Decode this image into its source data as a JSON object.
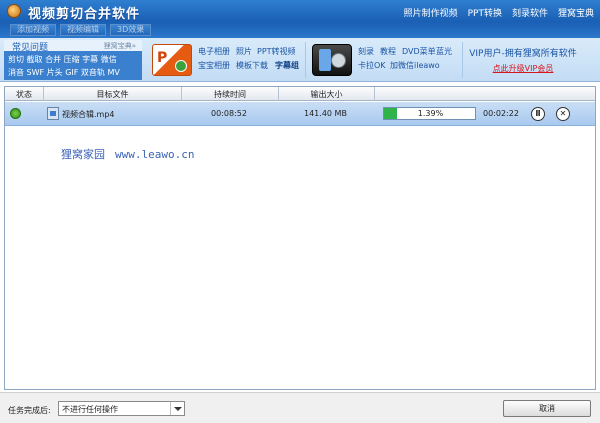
{
  "window": {
    "title": "视频剪切合并软件",
    "top_links": [
      "照片制作视频",
      "PPT转换",
      "刻录软件",
      "狸窝宝典"
    ]
  },
  "toolbar": {
    "buttons": [
      "添加视频",
      "视频编辑",
      "3D效果"
    ]
  },
  "banner": {
    "faq": {
      "title": "常见问题",
      "tag": "狸窝宝典»",
      "row1": "剪切 截取 合并 压缩 字幕 微信",
      "row2": "消音 SWF 片头 GIF 双音轨 MV"
    },
    "feature1": {
      "icon": "ppt-icon",
      "line1_a": "电子相册",
      "line1_b": "照片",
      "line1_c": "PPT转视频",
      "line2_a": "宝宝相册",
      "line2_b": "模板下载",
      "line2_c": "字幕组"
    },
    "feature2": {
      "icon": "phone-dvd-icon",
      "line1_a": "刻录",
      "line1_b": "教程",
      "line1_c": "DVD菜单",
      "line1_d": "蓝光",
      "line2_a": "卡拉OK",
      "line2_b": "加微信ileawo"
    },
    "vip": {
      "text": "VIP用户-拥有狸窝所有软件",
      "link": "点此升级VIP会员"
    }
  },
  "table": {
    "headers": {
      "status": "状态",
      "file": "目标文件",
      "duration": "持续时间",
      "size": "输出大小"
    },
    "rows": [
      {
        "file": "视频合辑.mp4",
        "duration": "00:08:52",
        "size": "141.40 MB",
        "progress_text": "1.39%",
        "progress": 0.0139,
        "remaining": "00:02:22"
      }
    ]
  },
  "watermark": {
    "name": "狸窝家园",
    "site": "www.leawo.cn"
  },
  "bottom": {
    "after_label": "任务完成后:",
    "after_value": "不进行任何操作",
    "cancel_label": "取消"
  },
  "colors": {
    "title_bar": "#1a5fb4",
    "row_selected": "#b3d0f2",
    "progress_fill": "#2fb34a",
    "vip_link": "#d7141b"
  }
}
